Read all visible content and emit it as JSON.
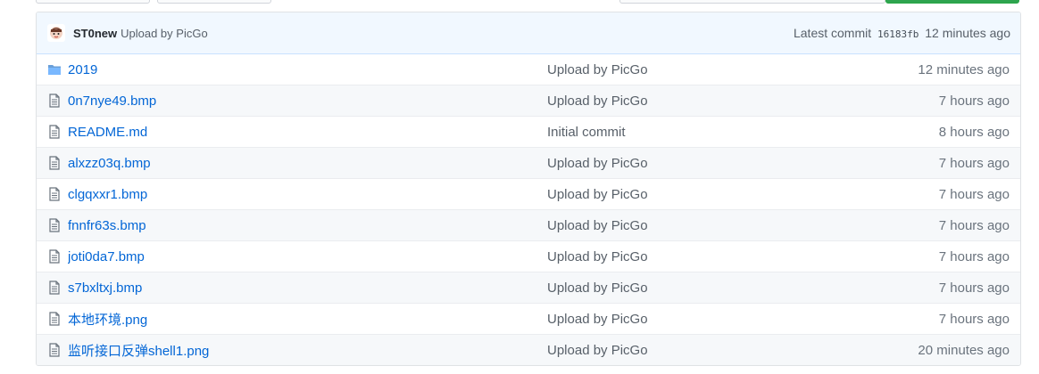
{
  "commit": {
    "author": "ST0new",
    "message": "Upload by PicGo",
    "latest_label": "Latest commit",
    "sha": "16183fb",
    "age": "12 minutes ago"
  },
  "files": [
    {
      "name": "2019",
      "type": "folder",
      "message": "Upload by PicGo",
      "age": "12 minutes ago"
    },
    {
      "name": "0n7nye49.bmp",
      "type": "file",
      "message": "Upload by PicGo",
      "age": "7 hours ago"
    },
    {
      "name": "README.md",
      "type": "file",
      "message": "Initial commit",
      "age": "8 hours ago"
    },
    {
      "name": "alxzz03q.bmp",
      "type": "file",
      "message": "Upload by PicGo",
      "age": "7 hours ago"
    },
    {
      "name": "clgqxxr1.bmp",
      "type": "file",
      "message": "Upload by PicGo",
      "age": "7 hours ago"
    },
    {
      "name": "fnnfr63s.bmp",
      "type": "file",
      "message": "Upload by PicGo",
      "age": "7 hours ago"
    },
    {
      "name": "joti0da7.bmp",
      "type": "file",
      "message": "Upload by PicGo",
      "age": "7 hours ago"
    },
    {
      "name": "s7bxltxj.bmp",
      "type": "file",
      "message": "Upload by PicGo",
      "age": "7 hours ago"
    },
    {
      "name": "本地环境.png",
      "type": "file",
      "message": "Upload by PicGo",
      "age": "7 hours ago"
    },
    {
      "name": "监听接口反弹shell1.png",
      "type": "file",
      "message": "Upload by PicGo",
      "age": "20 minutes ago"
    }
  ],
  "colors": {
    "link": "#0366d6",
    "commit_bar_bg": "#f1f8ff",
    "folder_icon": "#79b8ff",
    "file_icon": "#6a737d"
  }
}
